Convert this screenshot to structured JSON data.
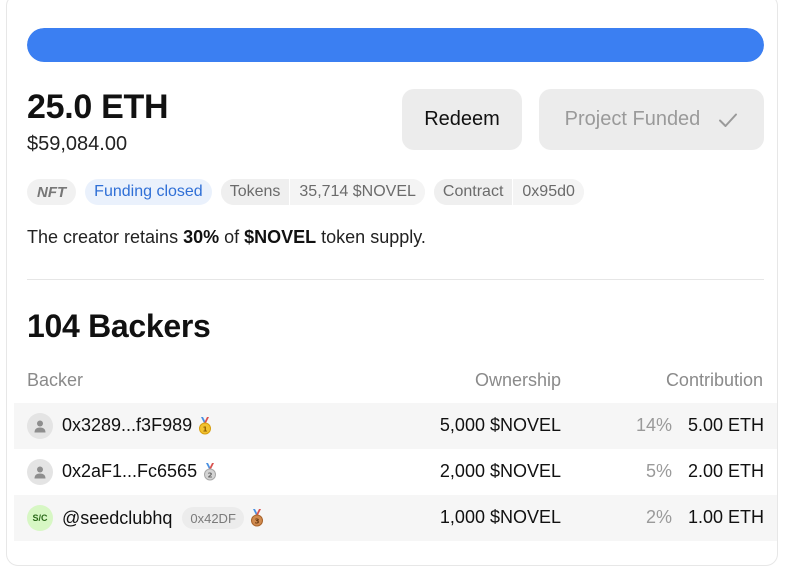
{
  "funding": {
    "progress_percent": 100,
    "amount_eth": "25.0 ETH",
    "amount_usd": "$59,084.00",
    "accent_color": "#3b7ff2"
  },
  "actions": {
    "redeem_label": "Redeem",
    "funded_label": "Project Funded",
    "funded_icon": "check-icon"
  },
  "tags": {
    "nft": "NFT",
    "status": "Funding closed",
    "tokens_key": "Tokens",
    "tokens_value": "35,714 $NOVEL",
    "contract_key": "Contract",
    "contract_value": "0x95d0"
  },
  "retains": {
    "prefix": "The creator retains ",
    "percent": "30%",
    "middle": " of ",
    "token": "$NOVEL",
    "suffix": " token supply."
  },
  "backers": {
    "title": "104 Backers",
    "columns": {
      "backer": "Backer",
      "ownership": "Ownership",
      "contribution": "Contribution"
    },
    "rows": [
      {
        "name": "0x3289...f3F989",
        "avatar": "user-icon",
        "medal": "gold-medal-icon",
        "ownership": "5,000 $NOVEL",
        "percent": "14%",
        "contribution": "5.00 ETH"
      },
      {
        "name": "0x2aF1...Fc6565",
        "avatar": "user-icon",
        "medal": "silver-medal-icon",
        "ownership": "2,000 $NOVEL",
        "percent": "5%",
        "contribution": "2.00 ETH"
      },
      {
        "name": "@seedclubhq",
        "avatar_text": "S/C",
        "address": "0x42DF",
        "medal": "bronze-medal-icon",
        "ownership": "1,000 $NOVEL",
        "percent": "2%",
        "contribution": "1.00 ETH"
      }
    ]
  }
}
